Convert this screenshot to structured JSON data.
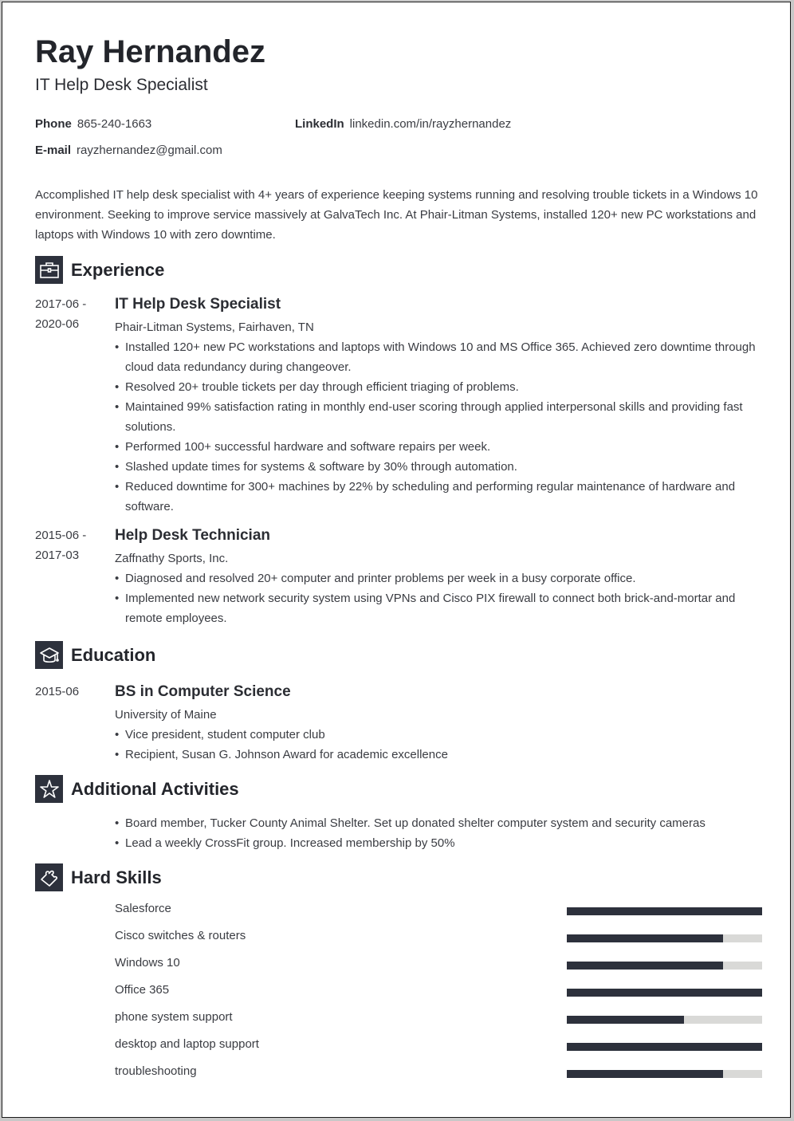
{
  "header": {
    "name": "Ray Hernandez",
    "title": "IT Help Desk Specialist",
    "contact": {
      "phone_label": "Phone",
      "phone": "865-240-1663",
      "linkedin_label": "LinkedIn",
      "linkedin": "linkedin.com/in/rayzhernandez",
      "email_label": "E-mail",
      "email": "rayzhernandez@gmail.com"
    }
  },
  "summary": "Accomplished IT help desk specialist with 4+ years of experience keeping systems running and resolving trouble tickets in a Windows 10 environment. Seeking to improve service massively at GalvaTech Inc. At Phair-Litman Systems, installed 120+ new PC workstations and laptops with Windows 10 with zero downtime.",
  "sections": {
    "experience": {
      "title": "Experience",
      "icon": "briefcase-icon",
      "jobs": [
        {
          "date_start": "2017-06 -",
          "date_end": "2020-06",
          "title": "IT Help Desk Specialist",
          "company": "Phair-Litman Systems, Fairhaven, TN",
          "bullets": [
            "Installed 120+ new PC workstations and laptops with Windows 10 and MS Office 365. Achieved zero downtime through cloud data redundancy during changeover.",
            "Resolved 20+ trouble tickets per day through efficient triaging of problems.",
            "Maintained 99% satisfaction rating in monthly end-user scoring through applied interpersonal skills and providing fast solutions.",
            "Performed 100+ successful hardware and software repairs per week.",
            "Slashed update times for systems & software by 30% through automation.",
            "Reduced downtime for 300+ machines by 22% by scheduling and performing regular maintenance of hardware and software."
          ]
        },
        {
          "date_start": "2015-06 -",
          "date_end": "2017-03",
          "title": "Help Desk Technician",
          "company": "Zaffnathy Sports, Inc.",
          "bullets": [
            "Diagnosed and resolved 20+ computer and printer problems per week in a busy corporate office.",
            "Implemented new network security system using VPNs and Cisco PIX firewall to connect both brick-and-mortar and remote employees."
          ]
        }
      ]
    },
    "education": {
      "title": "Education",
      "icon": "graduation-cap-icon",
      "date": "2015-06",
      "degree": "BS in Computer Science",
      "school": "University of Maine",
      "bullets": [
        "Vice president, student computer club",
        "Recipient, Susan G. Johnson Award for academic excellence"
      ]
    },
    "activities": {
      "title": "Additional Activities",
      "icon": "star-icon",
      "bullets": [
        "Board member, Tucker County Animal Shelter. Set up donated shelter computer system and security cameras",
        "Lead a weekly CrossFit group. Increased membership by 50%"
      ]
    },
    "skills": {
      "title": "Hard Skills",
      "icon": "puzzle-icon",
      "items": [
        {
          "name": "Salesforce",
          "level": 5,
          "max": 5
        },
        {
          "name": "Cisco switches & routers",
          "level": 4,
          "max": 5
        },
        {
          "name": "Windows 10",
          "level": 4,
          "max": 5
        },
        {
          "name": "Office 365",
          "level": 5,
          "max": 5
        },
        {
          "name": "phone system support",
          "level": 3,
          "max": 5
        },
        {
          "name": "desktop and laptop support",
          "level": 5,
          "max": 5
        },
        {
          "name": "troubleshooting",
          "level": 4,
          "max": 5
        }
      ]
    }
  },
  "colors": {
    "accent": "#2d313c",
    "bar_track": "#d9d9d7",
    "text": "#3a3c42"
  }
}
